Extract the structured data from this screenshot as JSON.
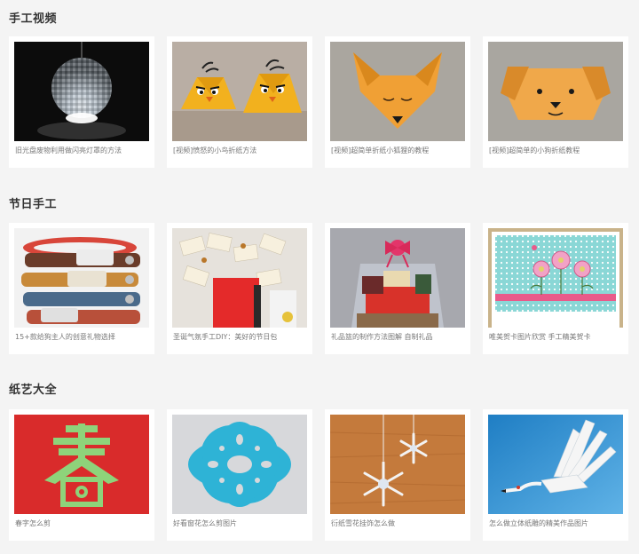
{
  "sections": [
    {
      "title": "手工视频",
      "items": [
        {
          "caption": "旧光盘废物利用做闪亮灯罩的方法",
          "image": "disco-ball-lamp-image"
        },
        {
          "caption": "[视频]愤怒的小鸟折纸方法",
          "image": "angry-birds-origami-image"
        },
        {
          "caption": "[视频]超简单折纸小狐狸的教程",
          "image": "origami-fox-image"
        },
        {
          "caption": "[视频]超简单的小狗折纸教程",
          "image": "origami-dog-image"
        }
      ]
    },
    {
      "title": "节日手工",
      "items": [
        {
          "caption": "15+款给狗主人的创意礼物选择",
          "image": "dog-collars-image"
        },
        {
          "caption": "圣诞气氛手工DIY：美好的节日包",
          "image": "christmas-tags-image"
        },
        {
          "caption": "礼品篮的制作方法图解 自制礼品",
          "image": "gift-basket-image"
        },
        {
          "caption": "唯美贺卡图片欣赏 手工精美贺卡",
          "image": "greeting-card-image"
        }
      ]
    },
    {
      "title": "纸艺大全",
      "items": [
        {
          "caption": "春字怎么剪",
          "image": "chun-papercut-image"
        },
        {
          "caption": "好看窗花怎么剪图片",
          "image": "window-flower-papercut-image"
        },
        {
          "caption": "衍纸雪花挂饰怎么做",
          "image": "quilling-snowflake-image"
        },
        {
          "caption": "怎么做立体纸雕的精美作品图片",
          "image": "paper-crane-sculpture-image"
        }
      ]
    }
  ]
}
